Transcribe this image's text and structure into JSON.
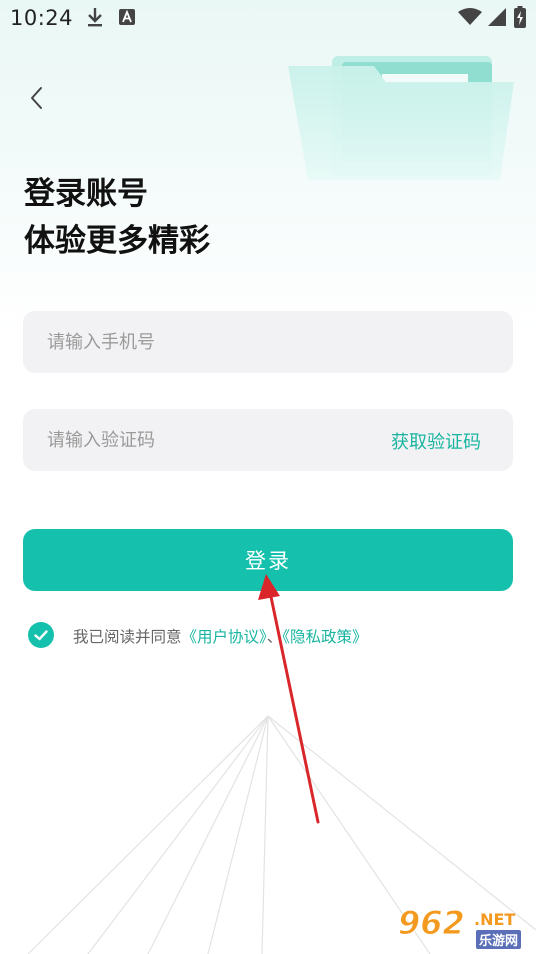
{
  "status_bar": {
    "time": "10:24",
    "icons": [
      "download-icon",
      "font-a-icon",
      "wifi-icon",
      "signal-icon",
      "battery-charging-icon"
    ]
  },
  "header": {
    "back_icon": "chevron-left-icon",
    "title_line1": "登录账号",
    "title_line2": "体验更多精彩",
    "decor_icon": "folder-icon"
  },
  "form": {
    "phone_placeholder": "请输入手机号",
    "phone_value": "",
    "code_placeholder": "请输入验证码",
    "code_value": "",
    "get_code_label": "获取验证码",
    "login_label": "登录"
  },
  "agreement": {
    "checked": true,
    "prefix": "我已阅读并同意",
    "user_agreement": "《用户协议》",
    "separator": "、",
    "privacy_policy": "《隐私政策》"
  },
  "colors": {
    "accent": "#15c1ad",
    "link": "#19b5a1",
    "field_bg": "#f2f2f4",
    "annotation_arrow": "#d9262b"
  },
  "watermark": {
    "brand": "962",
    "tld": ".NET",
    "cn": "乐游网"
  }
}
